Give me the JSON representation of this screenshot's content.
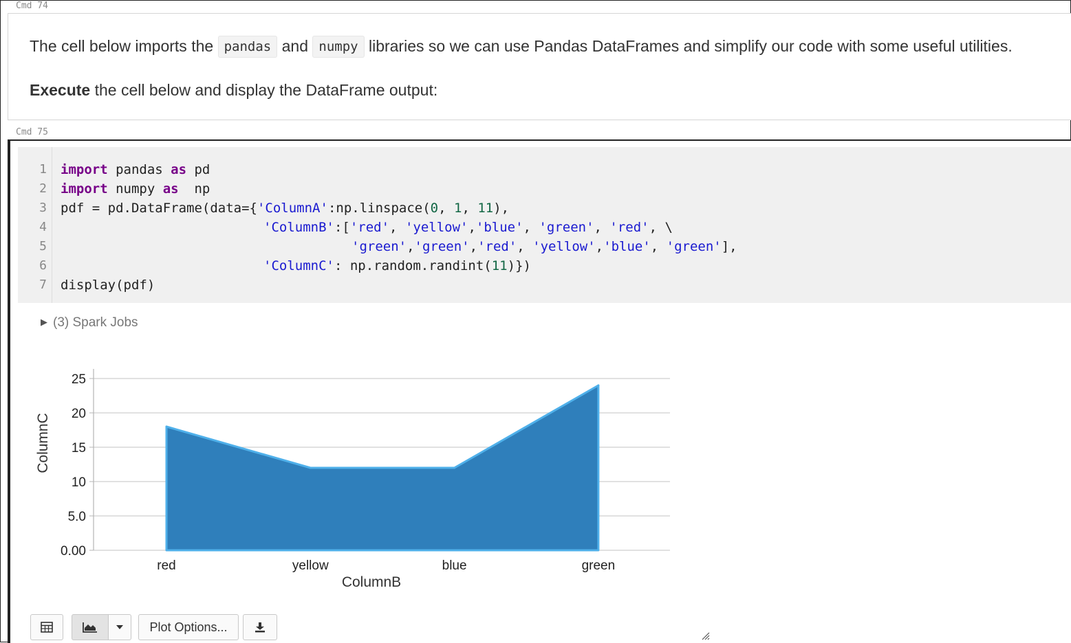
{
  "cells": {
    "cmd74_label": "Cmd 74",
    "cmd75_label": "Cmd 75"
  },
  "markdown": {
    "line1_prefix": "The cell below imports the",
    "pkg1": "pandas",
    "line1_and": "and",
    "pkg2": "numpy",
    "line1_suffix": "libraries so we can use Pandas DataFrames and simplify our code with some useful utilities.",
    "line2_bold": "Execute",
    "line2_rest": "the cell below and display the DataFrame output:"
  },
  "code": {
    "line_numbers": [
      "1",
      "2",
      "3",
      "4",
      "5",
      "6",
      "7"
    ],
    "l1": {
      "kw1": "import",
      "t1": " pandas ",
      "kw2": "as",
      "t2": " pd"
    },
    "l2": {
      "kw1": "import",
      "t1": " numpy ",
      "kw2": "as",
      "t2": "  np"
    },
    "l3": {
      "t1": "pdf = pd.DataFrame(data={",
      "s1": "'ColumnA'",
      "t2": ":np.linspace(",
      "n1": "0",
      "t3": ", ",
      "n2": "1",
      "t4": ", ",
      "n3": "11",
      "t5": "),"
    },
    "l4": {
      "s1": "'ColumnB'",
      "t1": ":[",
      "s2": "'red'",
      "t2": ", ",
      "s3": "'yellow'",
      "t3": ",",
      "s4": "'blue'",
      "t4": ", ",
      "s5": "'green'",
      "t5": ", ",
      "s6": "'red'",
      "t6": ", \\"
    },
    "l5": {
      "s1": "'green'",
      "t1": ",",
      "s2": "'green'",
      "t2": ",",
      "s3": "'red'",
      "t3": ", ",
      "s4": "'yellow'",
      "t4": ",",
      "s5": "'blue'",
      "t5": ", ",
      "s6": "'green'",
      "t6": "],"
    },
    "l6": {
      "s1": "'ColumnC'",
      "t1": ": np.random.randint(",
      "n1": "11",
      "t2": ")})"
    },
    "l7": {
      "t1": "display(pdf)"
    }
  },
  "spark_jobs": {
    "arrow": "▶",
    "label": "(3) Spark Jobs"
  },
  "chart_data": {
    "type": "area",
    "categories": [
      "red",
      "yellow",
      "blue",
      "green"
    ],
    "series": [
      {
        "values": [
          18,
          12,
          12,
          24
        ]
      }
    ],
    "xlabel": "ColumnB",
    "ylabel": "ColumnC",
    "ylim": [
      0,
      25
    ],
    "yticks": [
      "0.00",
      "5.0",
      "10",
      "15",
      "20",
      "25"
    ],
    "grid": true,
    "colors": {
      "fill": "#2f7fbb",
      "stroke": "#4fb0ea",
      "grid": "#cfcfcf",
      "axis": "#b5b5b5"
    }
  },
  "toolbar": {
    "table_icon": "table-icon",
    "chart_icon": "area-chart-icon",
    "dropdown_icon": "caret-down-icon",
    "plot_options_label": "Plot Options...",
    "download_icon": "download-icon"
  }
}
